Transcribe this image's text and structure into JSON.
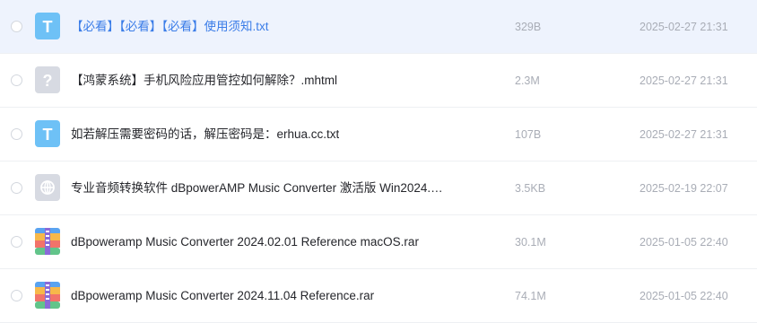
{
  "files": [
    {
      "type": "txt",
      "name": "【必看】【必看】【必看】使用须知.txt",
      "size": "329B",
      "date": "2025-02-27 21:31",
      "hover": true
    },
    {
      "type": "unknown",
      "name": "【鸿蒙系统】手机风险应用管控如何解除？.mhtml",
      "size": "2.3M",
      "date": "2025-02-27 21:31",
      "hover": false
    },
    {
      "type": "txt",
      "name": "如若解压需要密码的话，解压密码是：erhua.cc.txt",
      "size": "107B",
      "date": "2025-02-27 21:31",
      "hover": false
    },
    {
      "type": "web",
      "name": "专业音频转换软件 dBpowerAMP Music Converter 激活版 Win2024.…",
      "size": "3.5KB",
      "date": "2025-02-19 22:07",
      "hover": false
    },
    {
      "type": "zip",
      "name": "dBpoweramp Music Converter 2024.02.01 Reference macOS.rar",
      "size": "30.1M",
      "date": "2025-01-05 22:40",
      "hover": false
    },
    {
      "type": "zip",
      "name": "dBpoweramp Music Converter 2024.11.04 Reference.rar",
      "size": "74.1M",
      "date": "2025-01-05 22:40",
      "hover": false
    }
  ]
}
